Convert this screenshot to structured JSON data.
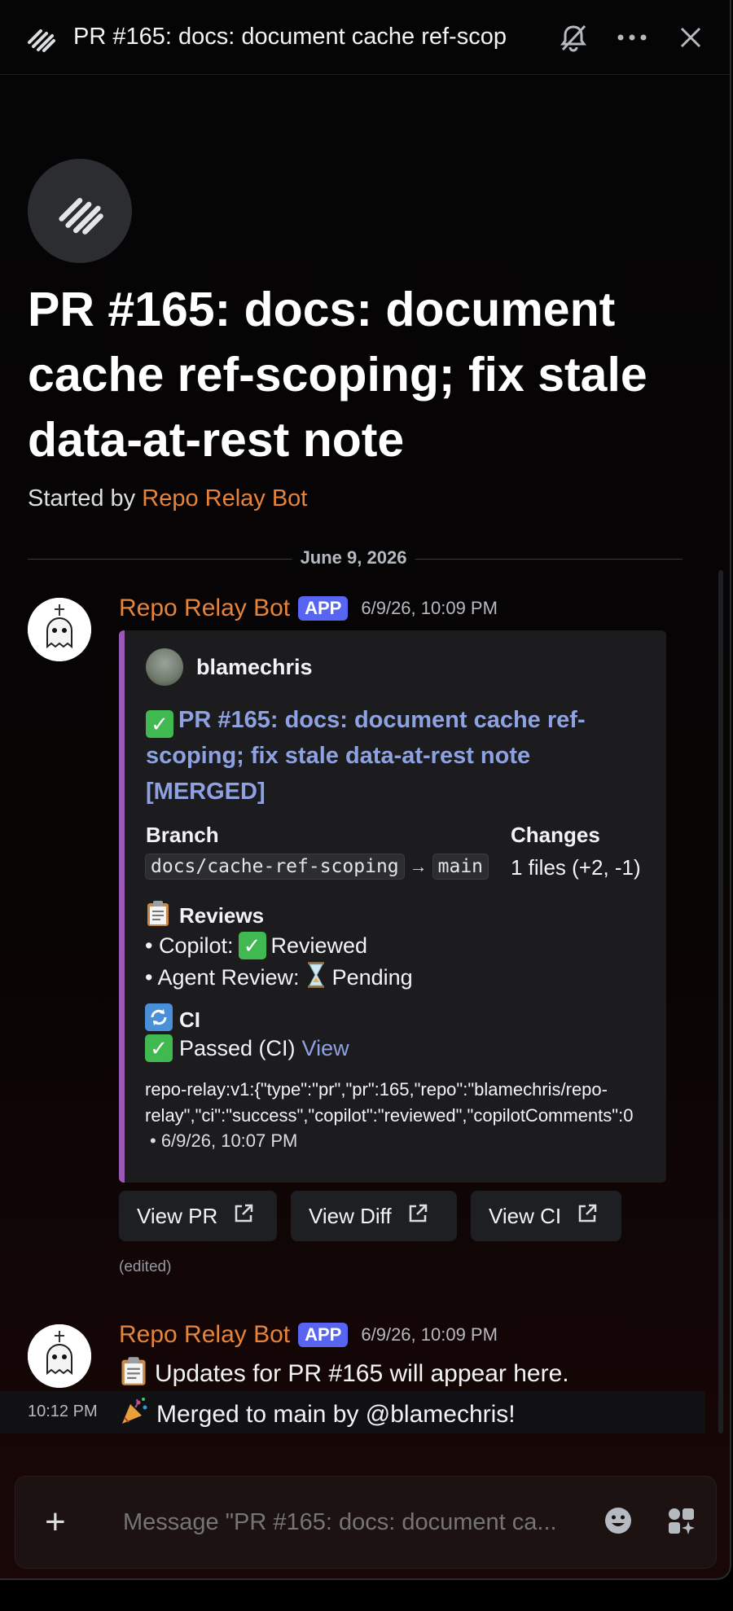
{
  "header": {
    "title": "PR #165: docs: document cache ref-scop",
    "icons": [
      "thread-icon",
      "mute-bell-icon",
      "more-icon",
      "close-icon"
    ]
  },
  "thread": {
    "title": "PR #165: docs: document cache ref-scoping; fix stale data-at-rest note",
    "started_prefix": "Started by",
    "started_by": "Repo Relay Bot",
    "date_divider": "June 9, 2026"
  },
  "messages": [
    {
      "author": "Repo Relay Bot",
      "badge": "APP",
      "timestamp": "6/9/26, 10:09 PM",
      "embed": {
        "author": "blamechris",
        "title_emoji": "✓",
        "title": "PR #165: docs: document cache ref-scoping; fix stale data-at-rest note [MERGED]",
        "branch_label": "Branch",
        "branch_from": "docs/cache-ref-scoping",
        "arrow": "→",
        "branch_to": "main",
        "changes_label": "Changes",
        "changes_value": "1 files (+2, -1)",
        "reviews_title": "Reviews",
        "review_1_prefix": "• Copilot:",
        "review_1_status": "Reviewed",
        "review_2_prefix": "• Agent Review:",
        "review_2_status": "Pending",
        "ci_title": "CI",
        "ci_status": "Passed (CI)",
        "ci_link": "View",
        "meta_line_1": "repo-relay:v1:{\"type\":\"pr\",\"pr\":165,\"repo\":\"blamechris/repo-",
        "meta_line_2": "relay\",\"ci\":\"success\",\"copilot\":\"reviewed\",\"copilotComments\":0",
        "footer": "• 6/9/26, 10:07 PM"
      },
      "buttons": [
        "View PR",
        "View Diff",
        "View CI"
      ],
      "edited": "(edited)"
    },
    {
      "author": "Repo Relay Bot",
      "badge": "APP",
      "timestamp": "6/9/26, 10:09 PM",
      "line_1": "Updates for PR #165 will appear here.",
      "line_2_timestamp": "10:12 PM",
      "line_2": "Merged to main by @blamechris!"
    }
  ],
  "composer": {
    "placeholder": "Message \"PR #165: docs: document ca..."
  },
  "colors": {
    "author": "#e8833a",
    "app_badge": "#5865f2",
    "link": "#8ea1e1",
    "embed_bar": "#9b59b6"
  }
}
